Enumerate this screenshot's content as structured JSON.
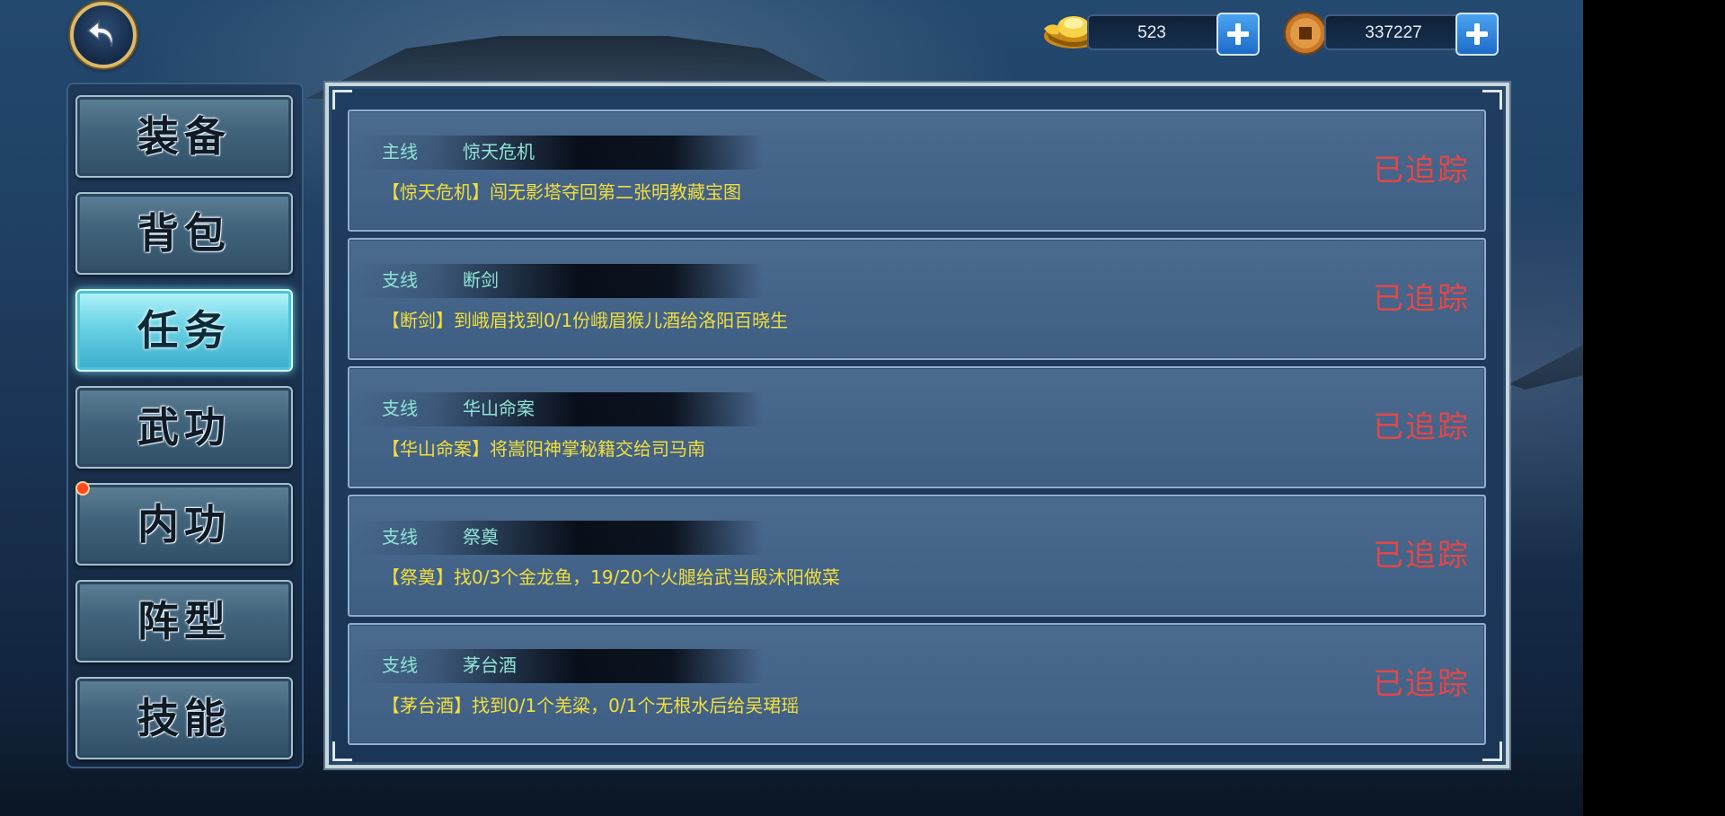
{
  "currency": {
    "ingot": {
      "icon": "gold-ingot-icon",
      "value": "523"
    },
    "coin": {
      "icon": "copper-coin-icon",
      "value": "337227"
    }
  },
  "tabs": [
    {
      "label": "装备",
      "active": false
    },
    {
      "label": "背包",
      "active": false
    },
    {
      "label": "任务",
      "active": true
    },
    {
      "label": "武功",
      "active": false
    },
    {
      "label": "内功",
      "active": false,
      "notification": true
    },
    {
      "label": "阵型",
      "active": false
    },
    {
      "label": "技能",
      "active": false
    }
  ],
  "quests": [
    {
      "type": "主线",
      "name": "惊天危机",
      "desc": "【惊天危机】闯无影塔夺回第二张明教藏宝图",
      "status": "已追踪"
    },
    {
      "type": "支线",
      "name": "断剑",
      "desc": "【断剑】到峨眉找到0/1份峨眉猴儿酒给洛阳百晓生",
      "status": "已追踪"
    },
    {
      "type": "支线",
      "name": "华山命案",
      "desc": "【华山命案】将嵩阳神掌秘籍交给司马南",
      "status": "已追踪"
    },
    {
      "type": "支线",
      "name": "祭奠",
      "desc": "【祭奠】找0/3个金龙鱼，19/20个火腿给武当殷沐阳做菜",
      "status": "已追踪"
    },
    {
      "type": "支线",
      "name": "茅台酒",
      "desc": "【茅台酒】找到0/1个羌粱，0/1个无根水后给吴珺瑶",
      "status": "已追踪"
    }
  ],
  "colors": {
    "quest_title": "#8fe3d6",
    "quest_desc": "#f2df3c",
    "tracked_status": "#e04848",
    "active_tab": "#6fd6e8"
  }
}
